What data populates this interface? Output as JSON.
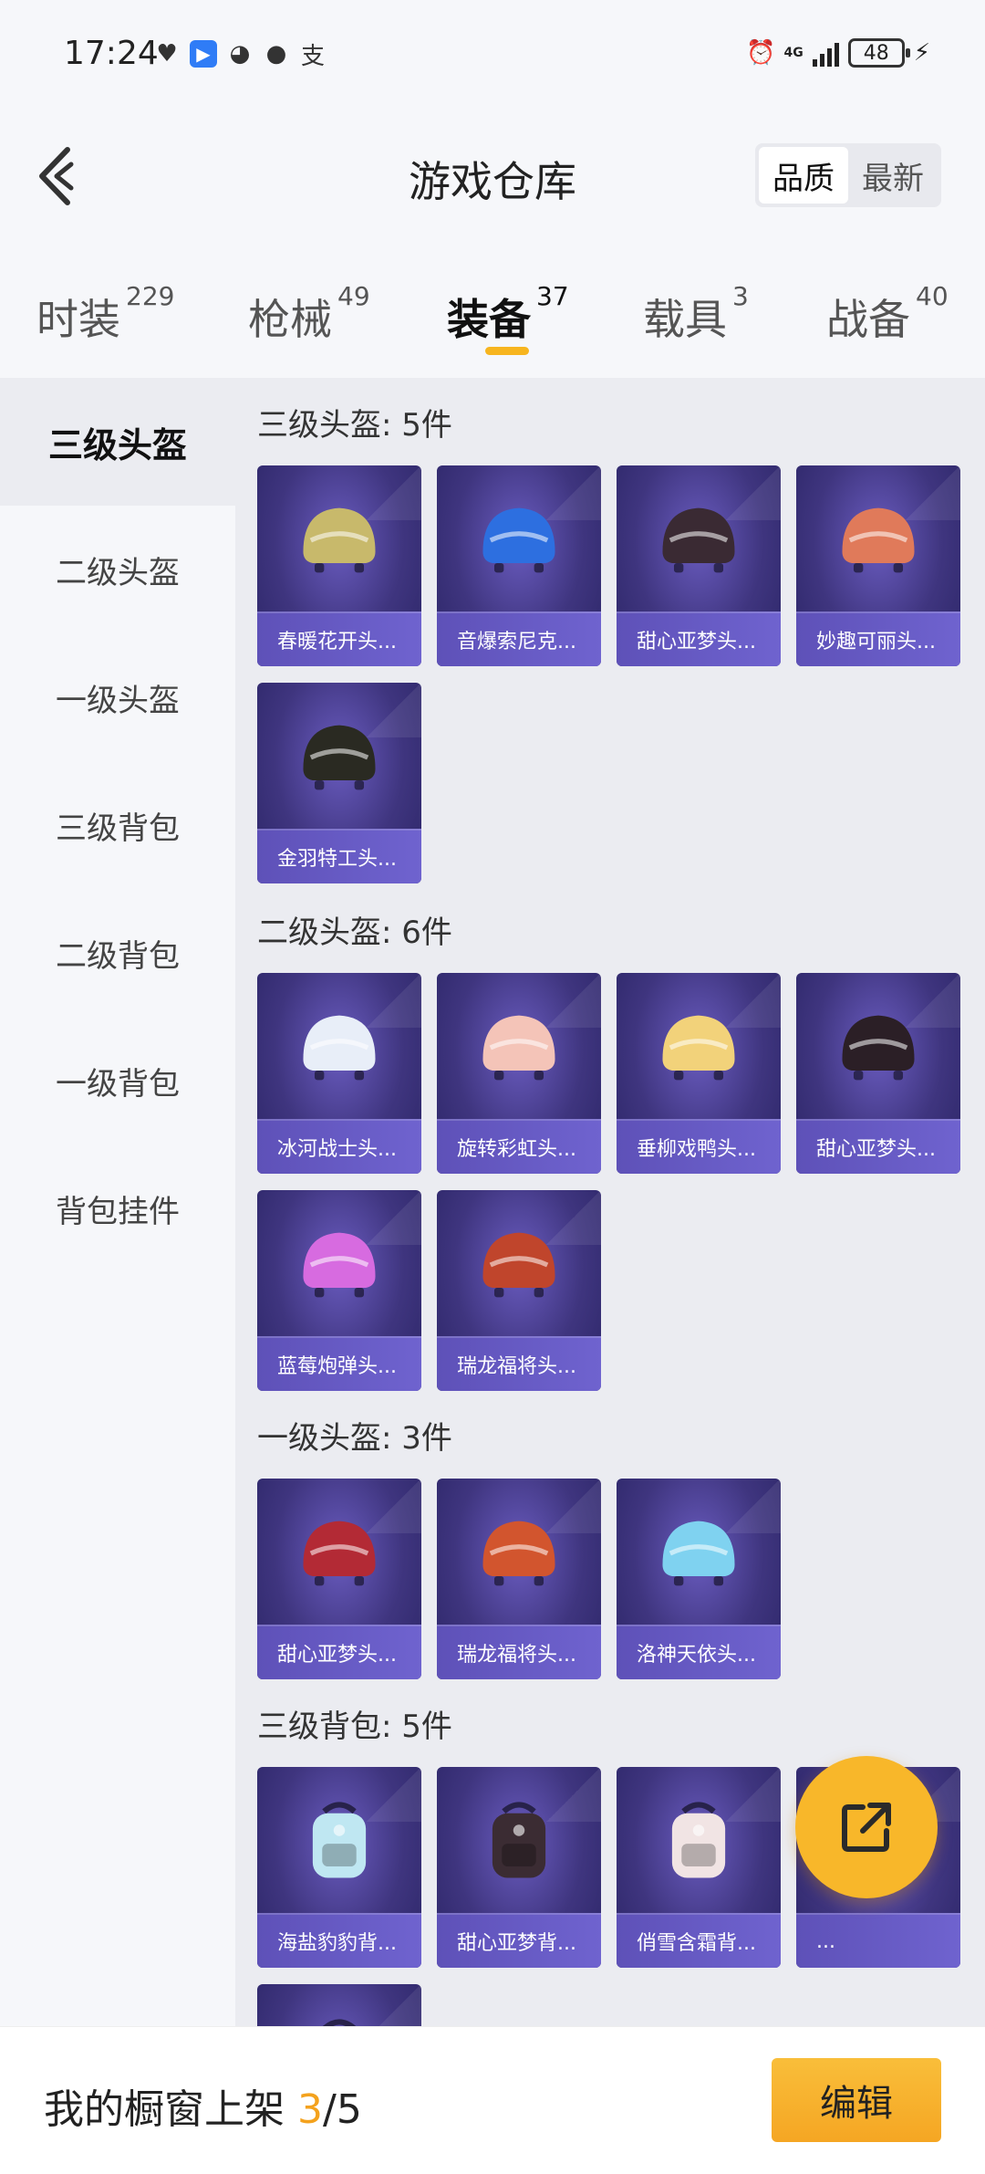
{
  "status_bar": {
    "time": "17:24",
    "network": "4G",
    "battery": "48"
  },
  "header": {
    "title": "游戏仓库",
    "sort": [
      "品质",
      "最新"
    ]
  },
  "tabs": [
    {
      "label": "时装",
      "count": "229"
    },
    {
      "label": "枪械",
      "count": "49"
    },
    {
      "label": "装备",
      "count": "37"
    },
    {
      "label": "载具",
      "count": "3"
    },
    {
      "label": "战备",
      "count": "40"
    }
  ],
  "sidebar": [
    "三级头盔",
    "二级头盔",
    "一级头盔",
    "三级背包",
    "二级背包",
    "一级背包",
    "背包挂件"
  ],
  "sections": [
    {
      "title": "三级头盔: 5件",
      "items": [
        "春暖花开头...",
        "音爆索尼克...",
        "甜心亚梦头...",
        "妙趣可丽头...",
        "金羽特工头..."
      ]
    },
    {
      "title": "二级头盔: 6件",
      "items": [
        "冰河战士头...",
        "旋转彩虹头...",
        "垂柳戏鸭头...",
        "甜心亚梦头...",
        "蓝莓炮弹头...",
        "瑞龙福将头..."
      ]
    },
    {
      "title": "一级头盔: 3件",
      "items": [
        "甜心亚梦头...",
        "瑞龙福将头...",
        "洛神天依头..."
      ]
    },
    {
      "title": "三级背包: 5件",
      "items": [
        "海盐豹豹背...",
        "甜心亚梦背...",
        "俏雪含霜背...",
        "..."
      ]
    }
  ],
  "colors": {
    "accent": "#f7b51f",
    "card_bg": "#3f357f",
    "card_label": "#6356c2"
  },
  "bottom": {
    "prefix": "我的橱窗上架 ",
    "current": "3",
    "suffix": "/5",
    "edit": "编辑"
  }
}
